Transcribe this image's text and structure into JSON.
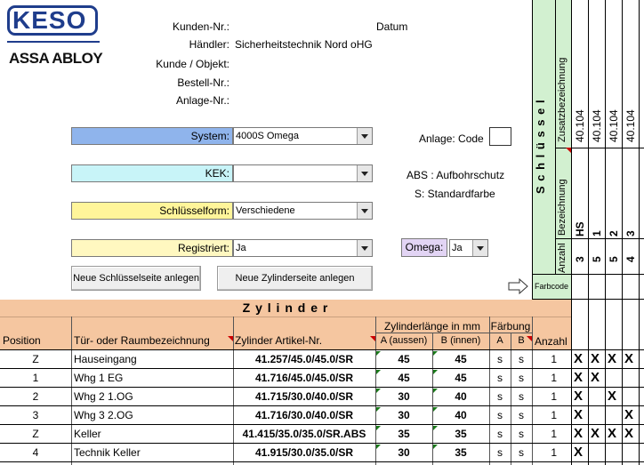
{
  "brand": {
    "logo": "KESO",
    "sub": "ASSA ABLOY"
  },
  "header": {
    "kunden_nr_label": "Kunden-Nr.:",
    "datum_label": "Datum",
    "haendler_label": "Händler:",
    "haendler_value": "Sicherheitstechnik Nord oHG",
    "kunde_label": "Kunde / Objekt:",
    "bestell_label": "Bestell-Nr.:",
    "anlage_label": "Anlage-Nr.:"
  },
  "form": {
    "system_label": "System:",
    "system_value": "4000S Omega",
    "kek_label": "KEK:",
    "kek_value": "",
    "schluesselform_label": "Schlüsselform:",
    "schluesselform_value": "Verschiedene",
    "registriert_label": "Registriert:",
    "registriert_value": "Ja",
    "omega_label": "Omega:",
    "omega_value": "Ja",
    "anlage_code_label": "Anlage: Code",
    "abs_text": "ABS  : Aufbohrschutz",
    "s_text": "S:    Standardfarbe",
    "btn_schluessel": "Neue Schlüsselseite anlegen",
    "btn_zylinder": "Neue Zylinderseite anlegen"
  },
  "keys_panel": {
    "title": "S c h l ü s s e l",
    "zusatz_label": "Zusatzbezeichnung",
    "bezeichnung_label": "Bezeichnung",
    "anzahl_label": "Anzahl",
    "farbcode_label": "Farbcode",
    "columns": [
      {
        "zusatz": "40.104",
        "bezeichnung": "HS",
        "anzahl": "3"
      },
      {
        "zusatz": "40.104",
        "bezeichnung": "1",
        "anzahl": "5"
      },
      {
        "zusatz": "40.104",
        "bezeichnung": "2",
        "anzahl": "5"
      },
      {
        "zusatz": "40.104",
        "bezeichnung": "3",
        "anzahl": "4"
      }
    ]
  },
  "table": {
    "title": "Z y l i n d e r",
    "col_position": "Position",
    "col_tuer": "Tür- oder Raumbezeichnung",
    "col_artikel": "Zylinder Artikel-Nr.",
    "col_laenge": "Zylinderlänge in mm",
    "col_a": "A (aussen)",
    "col_b": "B (innen)",
    "col_faerbung": "Färbung",
    "col_fa": "A",
    "col_fb": "B",
    "col_anzahl": "Anzahl",
    "rows": [
      {
        "pos": "Z",
        "name": "Hauseingang",
        "artikel": "41.257/45.0/45.0/SR",
        "a": "45",
        "b": "45",
        "fa": "s",
        "fb": "s",
        "anzahl": "1",
        "x": [
          "X",
          "X",
          "X",
          "X"
        ]
      },
      {
        "pos": "1",
        "name": "Whg 1 EG",
        "artikel": "41.716/45.0/45.0/SR",
        "a": "45",
        "b": "45",
        "fa": "s",
        "fb": "s",
        "anzahl": "1",
        "x": [
          "X",
          "X",
          "",
          ""
        ]
      },
      {
        "pos": "2",
        "name": "Whg 2 1.OG",
        "artikel": "41.715/30.0/40.0/SR",
        "a": "30",
        "b": "40",
        "fa": "s",
        "fb": "s",
        "anzahl": "1",
        "x": [
          "X",
          "",
          "X",
          ""
        ]
      },
      {
        "pos": "3",
        "name": "Whg 3 2.OG",
        "artikel": "41.716/30.0/40.0/SR",
        "a": "30",
        "b": "40",
        "fa": "s",
        "fb": "s",
        "anzahl": "1",
        "x": [
          "X",
          "",
          "",
          "X"
        ]
      },
      {
        "pos": "Z",
        "name": "Keller",
        "artikel": "41.415/35.0/35.0/SR.ABS",
        "a": "35",
        "b": "35",
        "fa": "s",
        "fb": "s",
        "anzahl": "1",
        "x": [
          "X",
          "X",
          "X",
          "X"
        ]
      },
      {
        "pos": "4",
        "name": "Technik Keller",
        "artikel": "41.915/30.0/35.0/SR",
        "a": "30",
        "b": "35",
        "fa": "s",
        "fb": "s",
        "anzahl": "1",
        "x": [
          "X",
          "",
          "",
          ""
        ]
      }
    ]
  },
  "colors": {
    "system": "#8fb4ec",
    "kek": "#c8f4f8",
    "schluesselform": "#fff59a",
    "registriert": "#fff8c0",
    "omega": "#e2d4f4",
    "header": "#f5c6a0",
    "keys": "#d2f0d0",
    "logo": "#1f3d8c"
  }
}
